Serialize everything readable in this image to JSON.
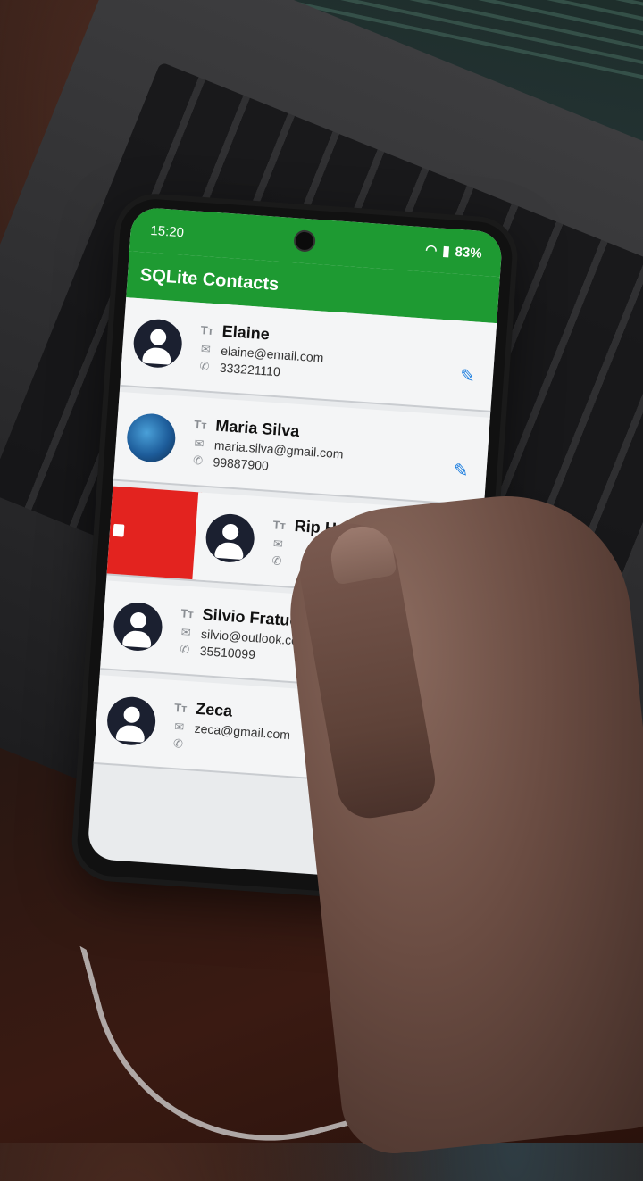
{
  "status_bar": {
    "time": "15:20",
    "battery": "83%"
  },
  "app_bar": {
    "title": "SQLite Contacts"
  },
  "contacts": [
    {
      "name": "Elaine",
      "email": "elaine@email.com",
      "phone": "333221110"
    },
    {
      "name": "Maria Silva",
      "email": "maria.silva@gmail.com",
      "phone": "99887900"
    },
    {
      "name": "Rip Hexa",
      "email": "",
      "phone": ""
    },
    {
      "name": "Silvio Fratuchelli",
      "email": "silvio@outlook.com",
      "phone": "35510099"
    },
    {
      "name": "Zeca",
      "email": "zeca@gmail.com",
      "phone": ""
    }
  ],
  "icons": {
    "name": "text-size-icon",
    "email": "envelope-icon",
    "phone": "phone-icon",
    "edit": "pencil-icon",
    "delete": "trash-icon"
  },
  "colors": {
    "app_bar": "#1e9a32",
    "delete": "#e3231f",
    "edit": "#1e7fe0"
  }
}
